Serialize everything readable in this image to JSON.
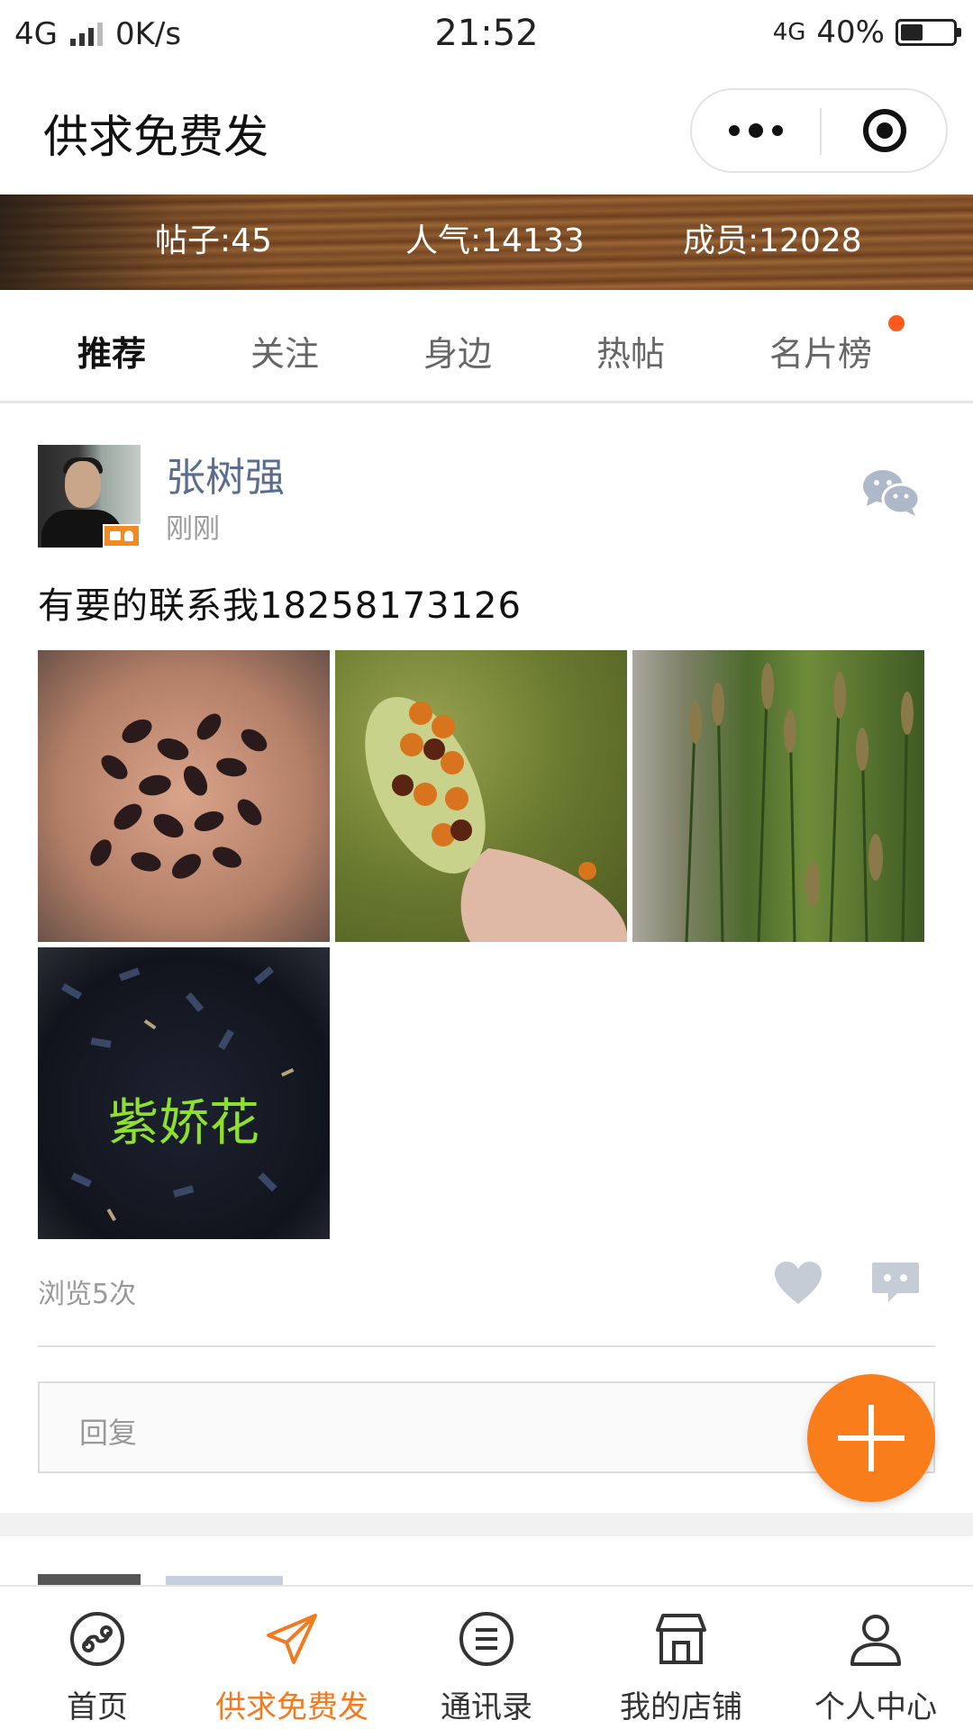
{
  "status_bar": {
    "network_left": "4G",
    "speed": "0K/s",
    "time": "21:52",
    "network_right": "4G",
    "battery": "40%"
  },
  "header": {
    "title": "供求免费发"
  },
  "banner": {
    "posts": "帖子:45",
    "popularity": "人气:14133",
    "members": "成员:12028"
  },
  "tabs": [
    {
      "label": "推荐",
      "active": true
    },
    {
      "label": "关注"
    },
    {
      "label": "身边"
    },
    {
      "label": "热帖"
    },
    {
      "label": "名片榜"
    }
  ],
  "post": {
    "author": "张树强",
    "time": "刚刚",
    "content": "有要的联系我18258173126",
    "photo_label": "紫娇花",
    "views": "浏览5次",
    "reply_placeholder": "回复"
  },
  "bottom_nav": [
    {
      "label": "首页",
      "icon": "mini-program-icon"
    },
    {
      "label": "供求免费发",
      "icon": "paper-plane-icon",
      "active": true
    },
    {
      "label": "通讯录",
      "icon": "contacts-list-icon"
    },
    {
      "label": "我的店铺",
      "icon": "store-icon"
    },
    {
      "label": "个人中心",
      "icon": "user-icon"
    }
  ],
  "colors": {
    "accent": "#fa7d1c",
    "author_name": "#5b6d8f",
    "notification_dot": "#ff5a1e"
  }
}
